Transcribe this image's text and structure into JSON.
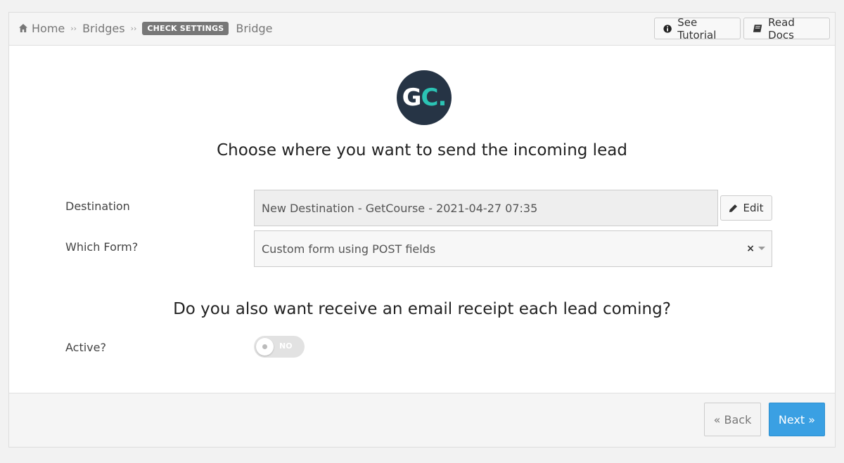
{
  "breadcrumb": {
    "home": "Home",
    "sep1": "››",
    "bridges": "Bridges",
    "sep2": "››",
    "badge": "CHECK SETTINGS",
    "current": "Bridge"
  },
  "toolbar": {
    "tutorial_label": "See Tutorial",
    "docs_label": "Read Docs"
  },
  "logo": {
    "part1": "G",
    "part2": "C."
  },
  "section1": {
    "heading": "Choose where you want to send the incoming lead"
  },
  "destination": {
    "label": "Destination",
    "value": "New Destination - GetCourse - 2021-04-27 07:35",
    "edit_label": "Edit"
  },
  "form_select": {
    "label": "Which Form?",
    "value": "Custom form using POST fields",
    "clear": "×"
  },
  "section2": {
    "heading": "Do you also want receive an email receipt each lead coming?"
  },
  "active": {
    "label": "Active?",
    "state": "NO"
  },
  "footer": {
    "back_label": "« Back",
    "next_label": "Next »"
  },
  "colors": {
    "primary": "#3aa0e3",
    "logo_bg": "#263445",
    "logo_accent": "#2bc3b4",
    "badge": "#777777"
  },
  "icons": {
    "home": "home-icon",
    "tutorial": "info-circle-icon",
    "docs": "book-icon",
    "edit": "pencil-icon"
  }
}
